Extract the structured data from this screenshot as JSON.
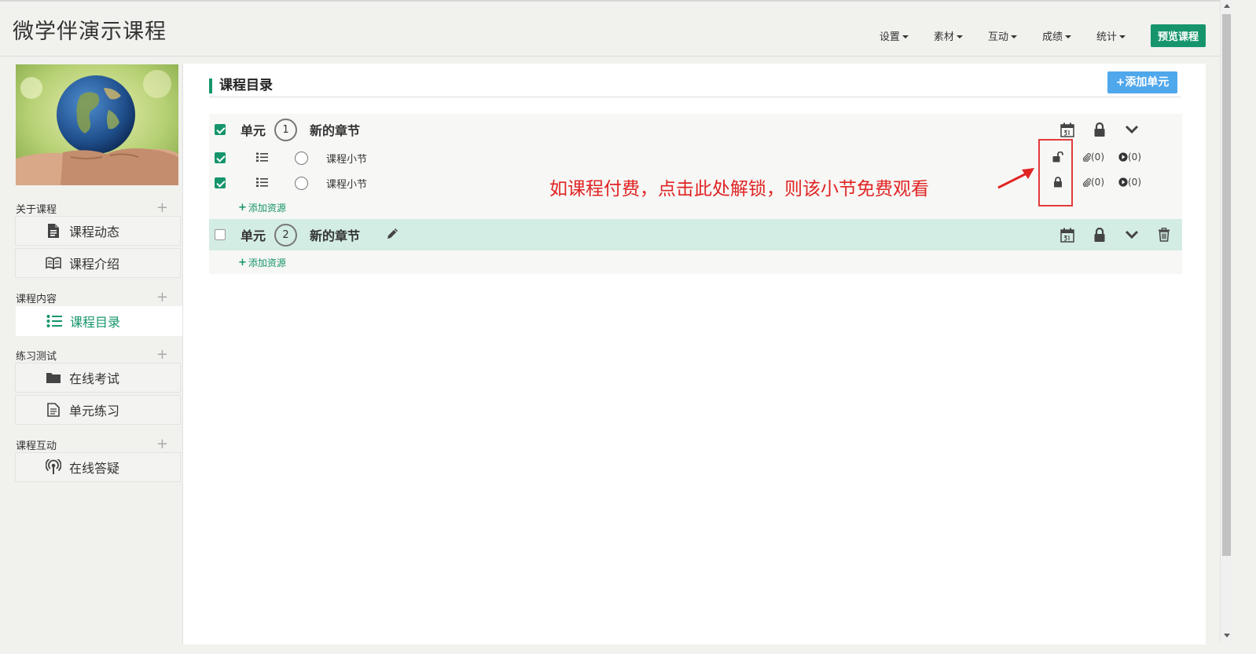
{
  "header": {
    "title": "微学伴演示课程",
    "nav": [
      {
        "label": "设置"
      },
      {
        "label": "素材"
      },
      {
        "label": "互动"
      },
      {
        "label": "成绩"
      },
      {
        "label": "统计"
      }
    ],
    "preview_label": "预览课程"
  },
  "sidebar": {
    "sections": [
      {
        "title": "关于课程",
        "items": [
          {
            "label": "课程动态",
            "icon": "document-icon"
          },
          {
            "label": "课程介绍",
            "icon": "book-icon"
          }
        ]
      },
      {
        "title": "课程内容",
        "items": [
          {
            "label": "课程目录",
            "icon": "list-icon",
            "active": true
          }
        ]
      },
      {
        "title": "练习测试",
        "items": [
          {
            "label": "在线考试",
            "icon": "folder-icon"
          },
          {
            "label": "单元练习",
            "icon": "file-icon"
          }
        ]
      },
      {
        "title": "课程互动",
        "items": [
          {
            "label": "在线答疑",
            "icon": "broadcast-icon"
          }
        ]
      }
    ],
    "plus_glyph": "+"
  },
  "main": {
    "title": "课程目录",
    "add_unit_label": "+添加单元",
    "units": [
      {
        "label": "单元",
        "number": "1",
        "name": "新的章节",
        "checked": true,
        "lessons": [
          {
            "name": "课程小节",
            "checked": true,
            "locked": false,
            "attachments": "(0)",
            "videos": "(0)"
          },
          {
            "name": "课程小节",
            "checked": true,
            "locked": true,
            "attachments": "(0)",
            "videos": "(0)"
          }
        ],
        "add_resource_label": "添加资源"
      },
      {
        "label": "单元",
        "number": "2",
        "name": "新的章节",
        "checked": false,
        "lessons": [],
        "add_resource_label": "添加资源"
      }
    ]
  },
  "annotation": {
    "text": "如课程付费，点击此处解锁，则该小节免费观看",
    "color": "#e02424"
  },
  "colors": {
    "accent": "#16956c",
    "button_blue": "#4fa7ec",
    "highlight_row": "#d3ece4"
  }
}
